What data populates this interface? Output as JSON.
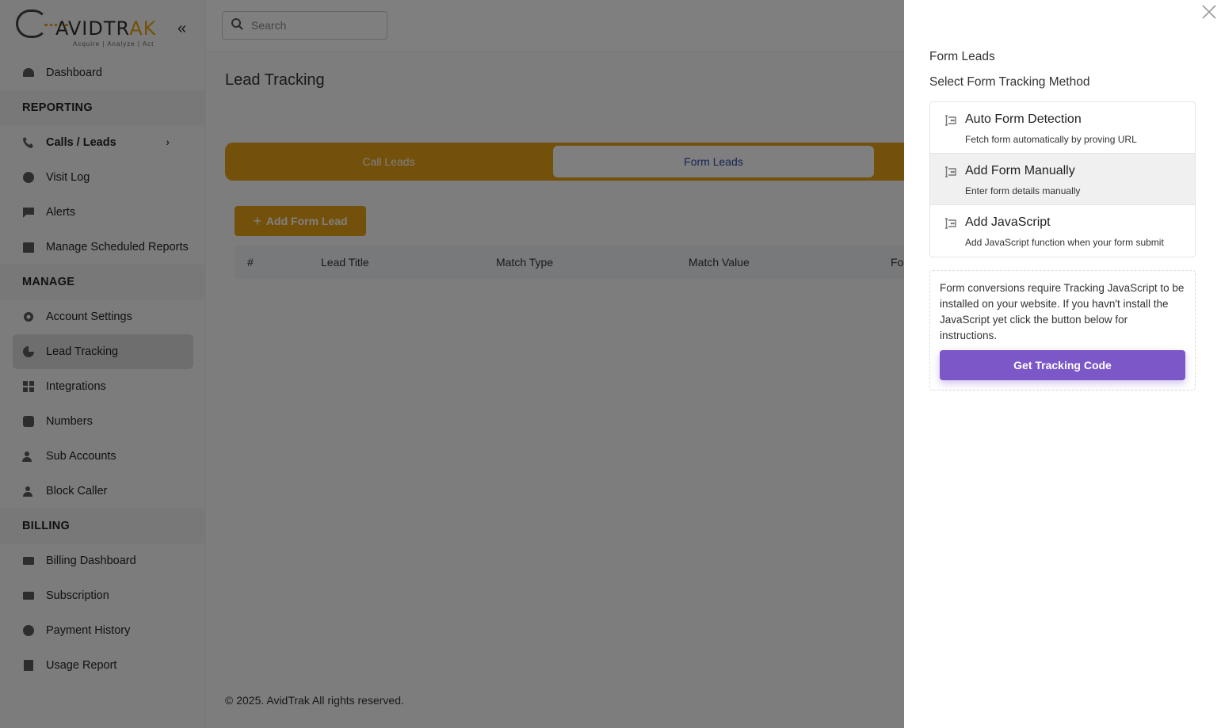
{
  "brand": {
    "name_part1": "AVIDTR",
    "name_part2": "AK",
    "tagline": "Acquire  |  Analyze  |  Act"
  },
  "sidebar": {
    "dashboard": "Dashboard",
    "section_reporting": "REPORTING",
    "calls_leads": "Calls / Leads",
    "visit_log": "Visit Log",
    "alerts": "Alerts",
    "manage_scheduled_reports": "Manage Scheduled Reports",
    "section_manage": "MANAGE",
    "account_settings": "Account Settings",
    "lead_tracking": "Lead Tracking",
    "integrations": "Integrations",
    "numbers": "Numbers",
    "sub_accounts": "Sub Accounts",
    "block_caller": "Block Caller",
    "section_billing": "BILLING",
    "billing_dashboard": "Billing Dashboard",
    "subscription": "Subscription",
    "payment_history": "Payment History",
    "usage_report": "Usage Report"
  },
  "search": {
    "placeholder": "Search"
  },
  "main": {
    "title": "Lead Tracking",
    "tab_call_leads": "Call Leads",
    "tab_form_leads": "Form Leads",
    "add_button": "Add Form Lead",
    "columns": [
      "#",
      "Lead Title",
      "Match Type",
      "Match Value",
      "Fo"
    ],
    "footer": "© 2025. AvidTrak All rights reserved."
  },
  "drawer": {
    "title": "Form Leads",
    "subtitle": "Select Form Tracking Method",
    "methods": [
      {
        "title": "Auto Form Detection",
        "desc": "Fetch form automatically by proving URL"
      },
      {
        "title": "Add Form Manually",
        "desc": "Enter form details manually"
      },
      {
        "title": "Add JavaScript",
        "desc": "Add JavaScript function when your form submit"
      }
    ],
    "info": "Form conversions require Tracking JavaScript to be installed on your website. If you havn't install the JavaScript yet click the button below for instructions.",
    "button": "Get Tracking Code"
  },
  "colors": {
    "accent": "#e8a317",
    "purple": "#7b57c8",
    "tab_text": "#2b4aa3"
  }
}
